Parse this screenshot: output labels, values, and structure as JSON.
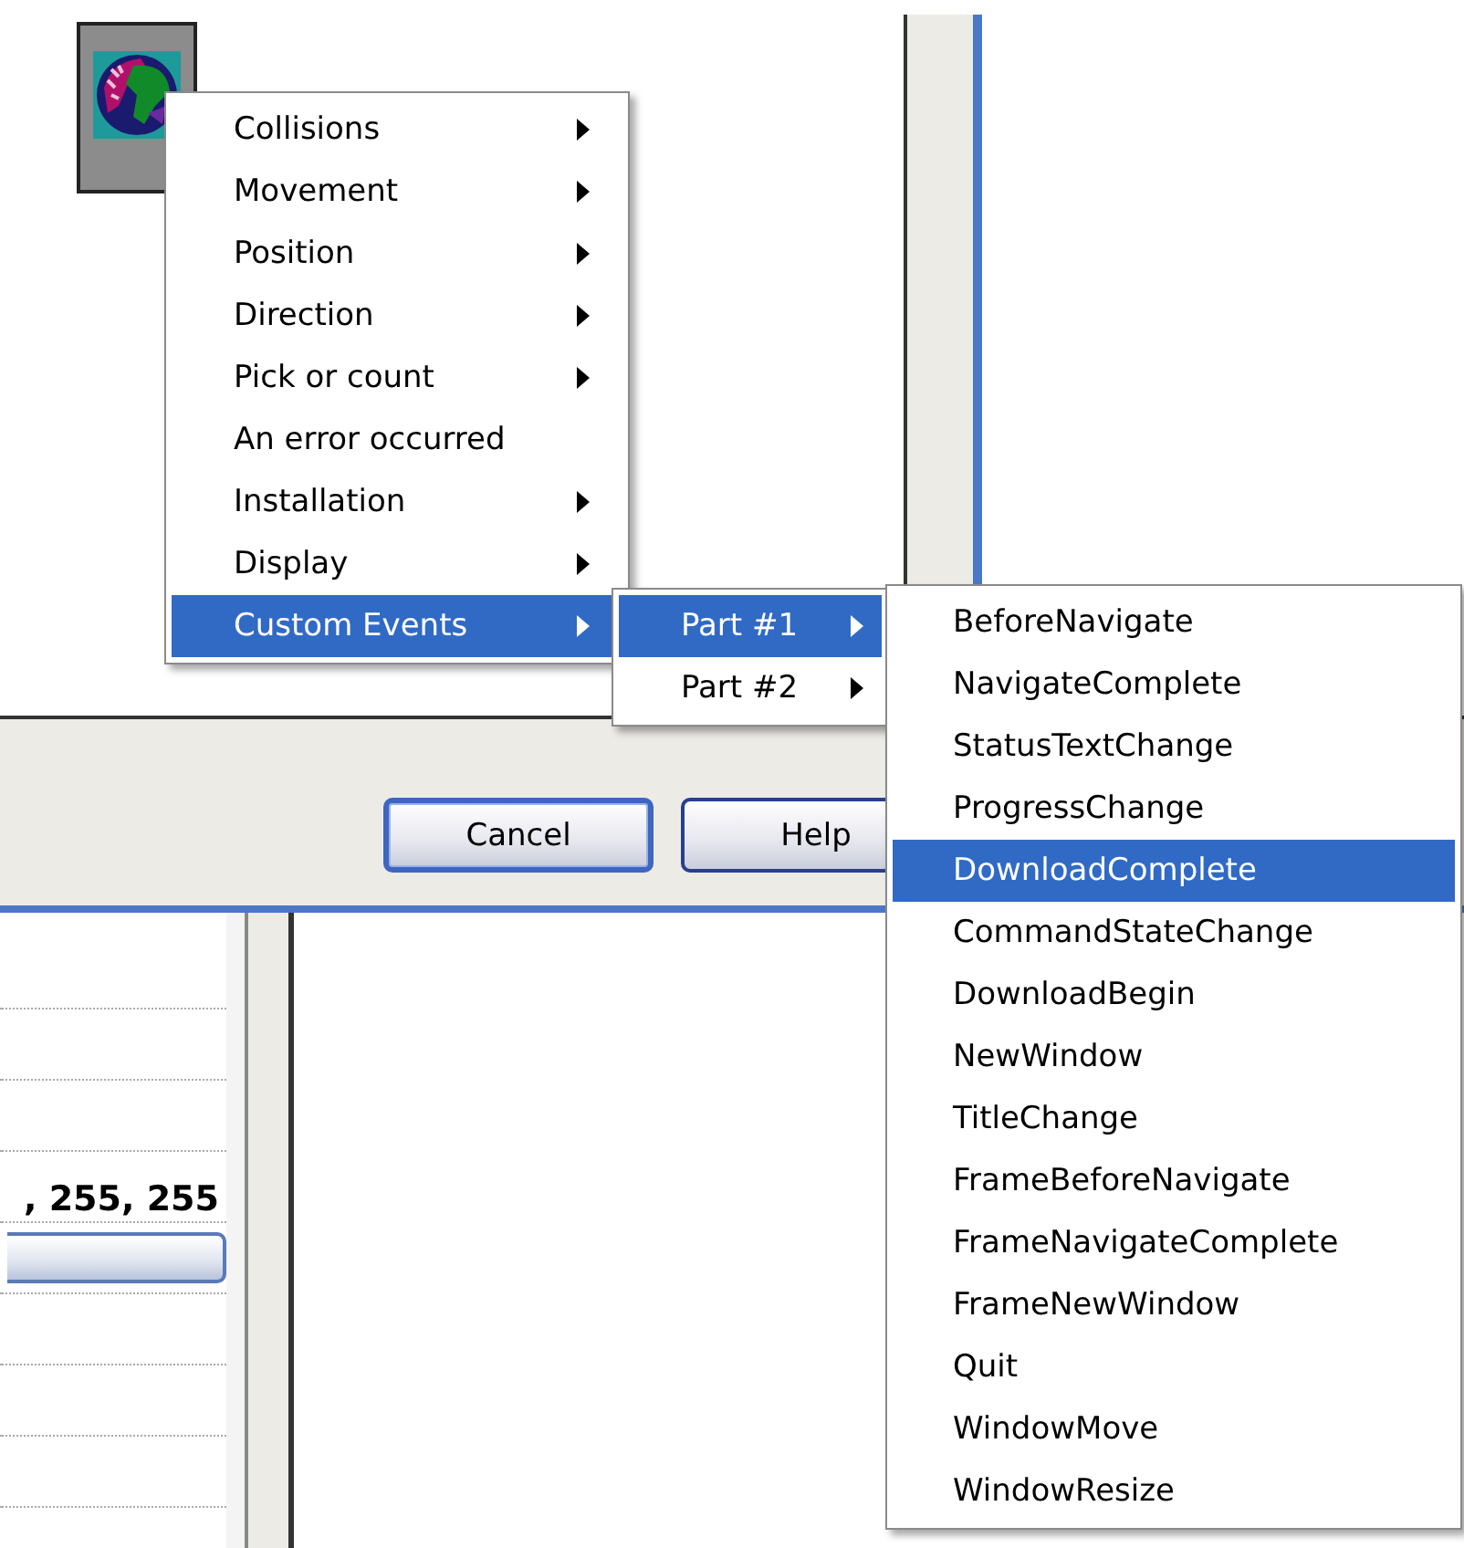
{
  "menu": {
    "items": [
      {
        "label": "Collisions",
        "submenu": true,
        "selected": false
      },
      {
        "label": "Movement",
        "submenu": true,
        "selected": false
      },
      {
        "label": "Position",
        "submenu": true,
        "selected": false
      },
      {
        "label": "Direction",
        "submenu": true,
        "selected": false
      },
      {
        "label": "Pick or count",
        "submenu": true,
        "selected": false
      },
      {
        "label": "An error occurred",
        "submenu": false,
        "selected": false
      },
      {
        "label": "Installation",
        "submenu": true,
        "selected": false
      },
      {
        "label": "Display",
        "submenu": true,
        "selected": false
      },
      {
        "label": "Custom Events",
        "submenu": true,
        "selected": true
      }
    ]
  },
  "submenu": {
    "items": [
      {
        "label": "Part #1",
        "submenu": true,
        "selected": true
      },
      {
        "label": "Part #2",
        "submenu": true,
        "selected": false
      }
    ]
  },
  "submenu_2": {
    "items": [
      {
        "label": "BeforeNavigate",
        "submenu": false,
        "selected": false
      },
      {
        "label": "NavigateComplete",
        "submenu": false,
        "selected": false
      },
      {
        "label": "StatusTextChange",
        "submenu": false,
        "selected": false
      },
      {
        "label": "ProgressChange",
        "submenu": false,
        "selected": false
      },
      {
        "label": "DownloadComplete",
        "submenu": false,
        "selected": true
      },
      {
        "label": "CommandStateChange",
        "submenu": false,
        "selected": false
      },
      {
        "label": "DownloadBegin",
        "submenu": false,
        "selected": false
      },
      {
        "label": "NewWindow",
        "submenu": false,
        "selected": false
      },
      {
        "label": "TitleChange",
        "submenu": false,
        "selected": false
      },
      {
        "label": "FrameBeforeNavigate",
        "submenu": false,
        "selected": false
      },
      {
        "label": "FrameNavigateComplete",
        "submenu": false,
        "selected": false
      },
      {
        "label": "FrameNewWindow",
        "submenu": false,
        "selected": false
      },
      {
        "label": "Quit",
        "submenu": false,
        "selected": false
      },
      {
        "label": "WindowMove",
        "submenu": false,
        "selected": false
      },
      {
        "label": "WindowResize",
        "submenu": false,
        "selected": false
      }
    ]
  },
  "buttons": [
    {
      "label": "Cancel",
      "default": true
    },
    {
      "label": "Help",
      "default": false
    }
  ],
  "property_panel": {
    "value": ", 255, 255"
  }
}
